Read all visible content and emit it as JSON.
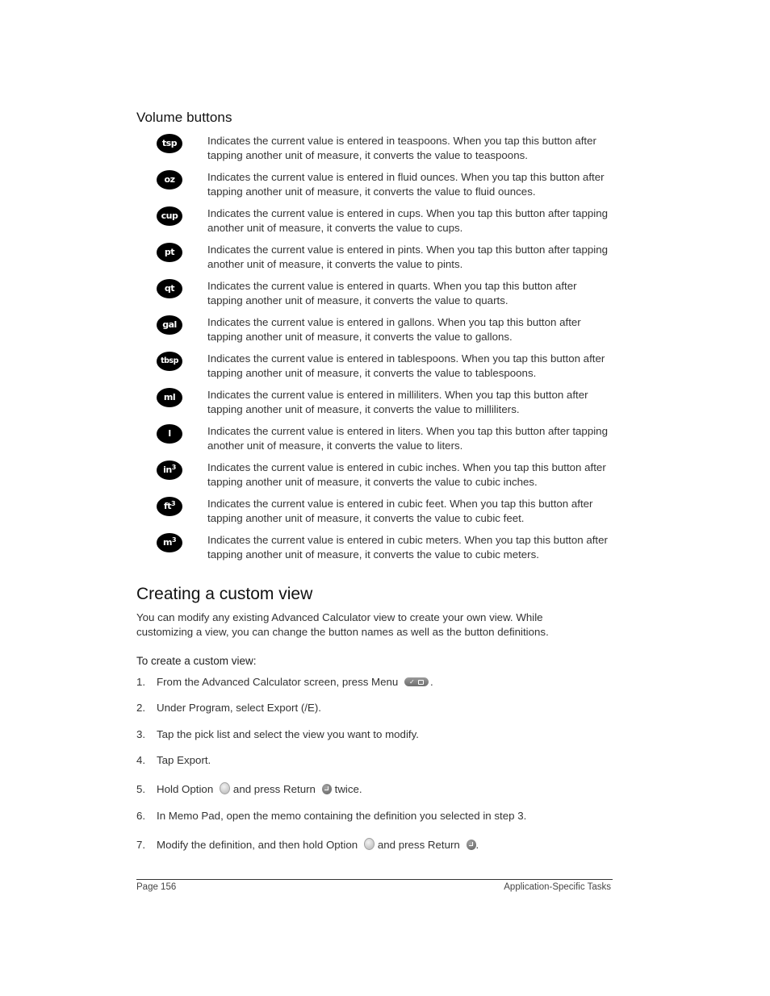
{
  "volume_section": {
    "heading": "Volume buttons",
    "buttons": [
      {
        "icon": "tsp",
        "description": "Indicates the current value is entered in teaspoons. When you tap this button after tapping another unit of measure, it converts the value to teaspoons."
      },
      {
        "icon": "oz",
        "description": "Indicates the current value is entered in fluid ounces. When you tap this button after tapping another unit of measure, it converts the value to fluid ounces."
      },
      {
        "icon": "cup",
        "description": "Indicates the current value is entered in cups. When you tap this button after tapping another unit of measure, it converts the value to cups."
      },
      {
        "icon": "pt",
        "description": "Indicates the current value is entered in pints. When you tap this button after tapping another unit of measure, it converts the value to pints."
      },
      {
        "icon": "qt",
        "description": "Indicates the current value is entered in quarts. When you tap this button after tapping another unit of measure, it converts the value to quarts."
      },
      {
        "icon": "gal",
        "description": "Indicates the current value is entered in gallons. When you tap this button after tapping another unit of measure, it converts the value to gallons."
      },
      {
        "icon": "tbsp",
        "description": "Indicates the current value is entered in tablespoons. When you tap this button after tapping another unit of measure, it converts the value to tablespoons."
      },
      {
        "icon": "ml",
        "description": "Indicates the current value is entered in milliliters. When you tap this button after tapping another unit of measure, it converts the value to milliliters."
      },
      {
        "icon": "l",
        "description": "Indicates the current value is entered in liters. When you tap this button after tapping another unit of measure, it converts the value to liters."
      },
      {
        "icon": "in",
        "icon_sup": "3",
        "description": "Indicates the current value is entered in cubic inches. When you tap this button after tapping another unit of measure, it converts the value to cubic inches."
      },
      {
        "icon": "ft",
        "icon_sup": "3",
        "description": "Indicates the current value is entered in cubic feet. When you tap this button after tapping another unit of measure, it converts the value to cubic feet."
      },
      {
        "icon": "m",
        "icon_sup": "3",
        "description": "Indicates the current value is entered in cubic meters. When you tap this button after tapping another unit of measure, it converts the value to cubic meters."
      }
    ]
  },
  "custom_view": {
    "heading": "Creating a custom view",
    "intro": "You can modify any existing Advanced Calculator view to create your own view. While customizing a view, you can change the button names as well as the button definitions.",
    "procedure_title": "To create a custom view:",
    "steps": [
      {
        "num": "1.",
        "text_a": "From the Advanced Calculator screen, press Menu",
        "text_b": "."
      },
      {
        "num": "2.",
        "text_a": "Under Program, select Export (/E)."
      },
      {
        "num": "3.",
        "text_a": "Tap the pick list and select the view you want to modify."
      },
      {
        "num": "4.",
        "text_a": "Tap Export."
      },
      {
        "num": "5.",
        "text_a": "Hold Option",
        "text_b": "and press Return",
        "text_c": "twice."
      },
      {
        "num": "6.",
        "text_a": "In Memo Pad, open the memo containing the definition you selected in step 3."
      },
      {
        "num": "7.",
        "text_a": "Modify the definition, and then hold Option",
        "text_b": "and press Return",
        "text_c": "."
      }
    ]
  },
  "footer": {
    "page_label": "Page 156",
    "section_label": "Application-Specific Tasks"
  }
}
